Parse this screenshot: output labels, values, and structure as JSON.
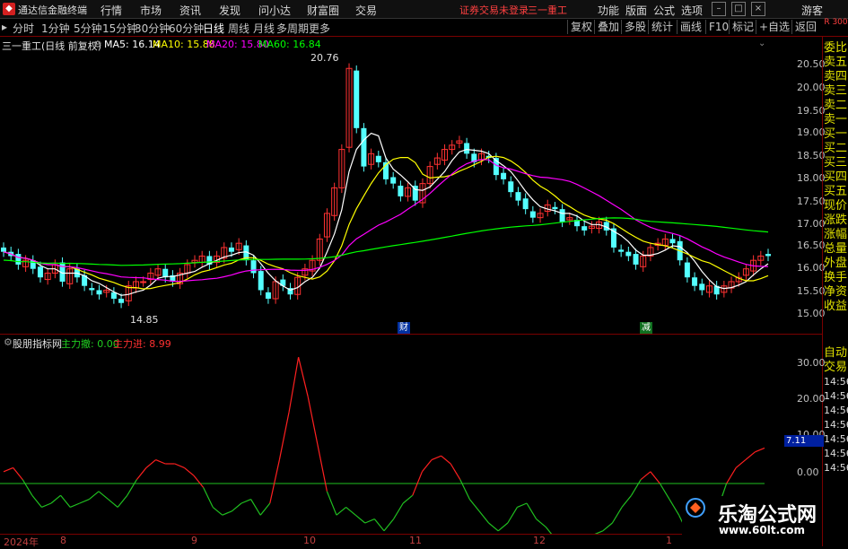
{
  "menubar": {
    "app_title": "通达信金融终端",
    "items": [
      "行情",
      "市场",
      "资讯",
      "发现",
      "问小达",
      "财富圈",
      "交易"
    ],
    "notice": "证券交易未登录",
    "stock": "三一重工",
    "right_items": [
      "功能",
      "版面",
      "公式",
      "选项"
    ],
    "guest": "游客",
    "window_buttons": [
      "minimize-icon",
      "maximize-icon",
      "close-icon"
    ]
  },
  "toolbar": {
    "periods": [
      "分时",
      "1分钟",
      "5分钟",
      "15分钟",
      "30分钟",
      "60分钟",
      "日线",
      "周线",
      "月线",
      "多周期",
      "更多"
    ],
    "active": "日线",
    "right_buttons": [
      "复权",
      "叠加",
      "多股",
      "统计",
      "画线",
      "F10",
      "标记",
      "+自选",
      "返回"
    ],
    "corner": "R 300"
  },
  "main_panel": {
    "title": "三一重工(日线 前复权)",
    "ma": [
      {
        "label": "MA5: 16.14",
        "color": "#ffffff"
      },
      {
        "label": "MA10: 15.88",
        "color": "#ffff00"
      },
      {
        "label": "MA20: 15.80",
        "color": "#ff00ff"
      },
      {
        "label": "MA60: 16.84",
        "color": "#00ff00"
      }
    ],
    "high_label": "20.76",
    "low_label": "14.85",
    "markers": [
      "财",
      "减"
    ]
  },
  "price_axis": [
    "20.50",
    "20.00",
    "19.50",
    "19.00",
    "18.50",
    "18.00",
    "17.50",
    "17.00",
    "16.50",
    "16.00",
    "15.50",
    "15.00"
  ],
  "side_panel": [
    "委比",
    "卖五",
    "卖四",
    "卖三",
    "卖二",
    "卖一",
    "买一",
    "买二",
    "买三",
    "买四",
    "买五",
    "现价",
    "涨跌",
    "涨幅",
    "总量",
    "外盘",
    "换手",
    "净资",
    "收益"
  ],
  "side_panel_lower": [
    "自动",
    "交易",
    "14:56",
    "14:56",
    "14:56",
    "14:56",
    "14:56",
    "14:56",
    "14:56"
  ],
  "indicator_panel": {
    "title": "股朋指标网",
    "out_label": "主力撤: 0.00",
    "in_label": "主力进: 8.99",
    "axis": [
      "30.00",
      "20.00",
      "10.00",
      "0.00"
    ],
    "current_value": "7.11"
  },
  "time_axis": [
    "2024年",
    "8",
    "9",
    "10",
    "11",
    "12",
    "1"
  ],
  "watermark": {
    "line1": "乐淘公式网",
    "line2": "www.60lt.com"
  },
  "colors": {
    "up": "#ff3232",
    "down": "#54ffff",
    "ma5": "#ffffff",
    "ma10": "#ffff00",
    "ma20": "#ff00ff",
    "ma60": "#00ff00",
    "ind_red": "#ff2020",
    "ind_green": "#20c020"
  },
  "chart_data": {
    "type": "candlestick",
    "title": "三一重工(日线 前复权)",
    "ylim": [
      14.8,
      20.9
    ],
    "x": [
      "2024年",
      "8",
      "9",
      "10",
      "11",
      "12",
      "1"
    ],
    "ohlc_closes": [
      16.3,
      16.2,
      16.0,
      16.1,
      15.9,
      15.7,
      15.8,
      16.0,
      15.6,
      15.9,
      15.7,
      15.5,
      15.4,
      15.3,
      15.4,
      15.2,
      15.1,
      15.5,
      15.6,
      15.6,
      15.8,
      15.9,
      15.7,
      15.6,
      15.8,
      16.0,
      16.1,
      16.2,
      16.0,
      16.2,
      16.4,
      16.3,
      16.5,
      16.1,
      15.8,
      15.4,
      15.2,
      15.6,
      15.5,
      15.3,
      15.7,
      15.9,
      16.1,
      16.6,
      17.2,
      17.8,
      18.7,
      20.6,
      19.2,
      18.3,
      18.6,
      18.4,
      18.0,
      17.9,
      17.6,
      17.8,
      17.5,
      17.9,
      18.3,
      18.5,
      18.7,
      18.8,
      18.9,
      18.6,
      18.4,
      18.6,
      18.5,
      18.1,
      18.0,
      17.7,
      17.5,
      17.3,
      17.1,
      17.2,
      17.4,
      17.3,
      17.0,
      17.1,
      16.9,
      16.8,
      16.9,
      17.0,
      16.8,
      16.4,
      16.3,
      16.2,
      16.0,
      16.2,
      16.4,
      16.5,
      16.6,
      16.5,
      16.1,
      15.7,
      15.5,
      15.4,
      15.5,
      15.3,
      15.5,
      15.6,
      15.7,
      15.9,
      16.1,
      16.2,
      16.2
    ],
    "ma60_start": 16.0,
    "ma60_end": 16.84,
    "ind_ylim": [
      -10,
      35
    ],
    "ind_values": [
      3,
      4,
      1,
      -3,
      -6,
      -5,
      -3,
      -6,
      -5,
      -4,
      -2,
      -4,
      -6,
      -3,
      1,
      4,
      6,
      5,
      5,
      4,
      2,
      -1,
      -6,
      -8,
      -7,
      -5,
      -4,
      -8,
      -5,
      6,
      18,
      32,
      22,
      10,
      -2,
      -8,
      -6,
      -8,
      -10,
      -9,
      -12,
      -9,
      -5,
      -3,
      3,
      6,
      7,
      5,
      1,
      -4,
      -7,
      -10,
      -12,
      -10,
      -6,
      -5,
      -9,
      -11,
      -14,
      -17,
      -20,
      -15,
      -13,
      -12,
      -10,
      -6,
      -3,
      1,
      3,
      0,
      -4,
      -8,
      -13,
      -15,
      -12,
      -7,
      0,
      4,
      6,
      8,
      9
    ]
  }
}
